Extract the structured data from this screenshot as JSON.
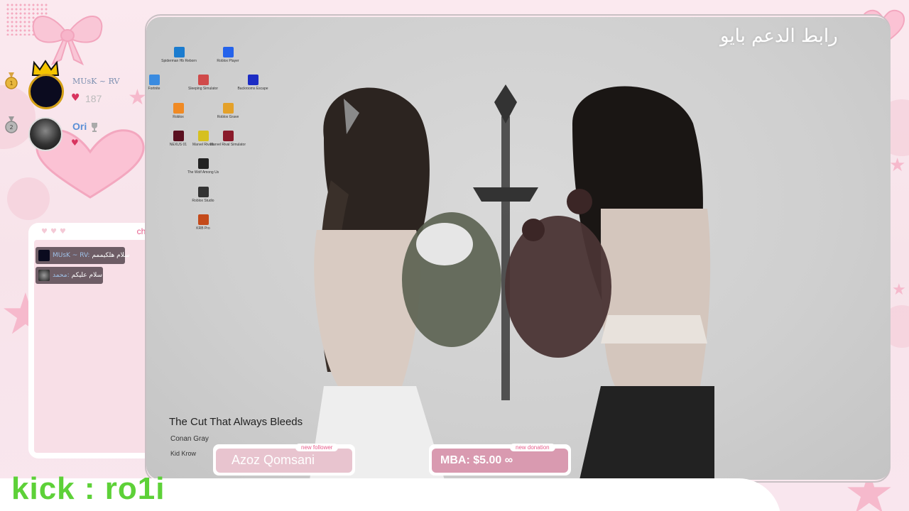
{
  "overlay": {
    "arabic_title": "رابط الدعم بايو",
    "kick_label": "kick : ro1i"
  },
  "leaderboard": [
    {
      "rank": "1",
      "name": "MUsK ~ RV",
      "count": "187"
    },
    {
      "rank": "2",
      "name": "Ori"
    }
  ],
  "chat": {
    "tab_label": "chat",
    "messages": [
      {
        "user": "MUsK ~ RV:",
        "text": "سلام هلكيممم"
      },
      {
        "user": "محمد:",
        "text": "سلام عليكم"
      }
    ]
  },
  "desktop": {
    "icons": [
      {
        "label": "Spiderman Hb Reborn"
      },
      {
        "label": "Roblox Player"
      },
      {
        "label": "Fortnite"
      },
      {
        "label": "Sleeping Simulator"
      },
      {
        "label": "Backrooms Escape"
      },
      {
        "label": "Roblox"
      },
      {
        "label": "Roblox Grave"
      },
      {
        "label": "NEXUS 01"
      },
      {
        "label": "Marvel Rivals"
      },
      {
        "label": "Marvel Rival Simulator"
      },
      {
        "label": "The Wolf Among Us"
      },
      {
        "label": "Roblox Studio"
      },
      {
        "label": "KRB Pro"
      }
    ],
    "now_playing": {
      "title": "The Cut That Always Bleeds",
      "artist": "Conan Gray",
      "requester": "Kid Krow"
    }
  },
  "alerts": {
    "follower": {
      "tag": "new follower",
      "name": "Azoz Qomsani"
    },
    "donation": {
      "tag": "new donation",
      "text": "MBA: $5.00 ∞"
    }
  },
  "colors": {
    "accent_pink": "#e75c8b",
    "kick_green": "#5dd138",
    "background_pink": "#fbe9ef"
  }
}
